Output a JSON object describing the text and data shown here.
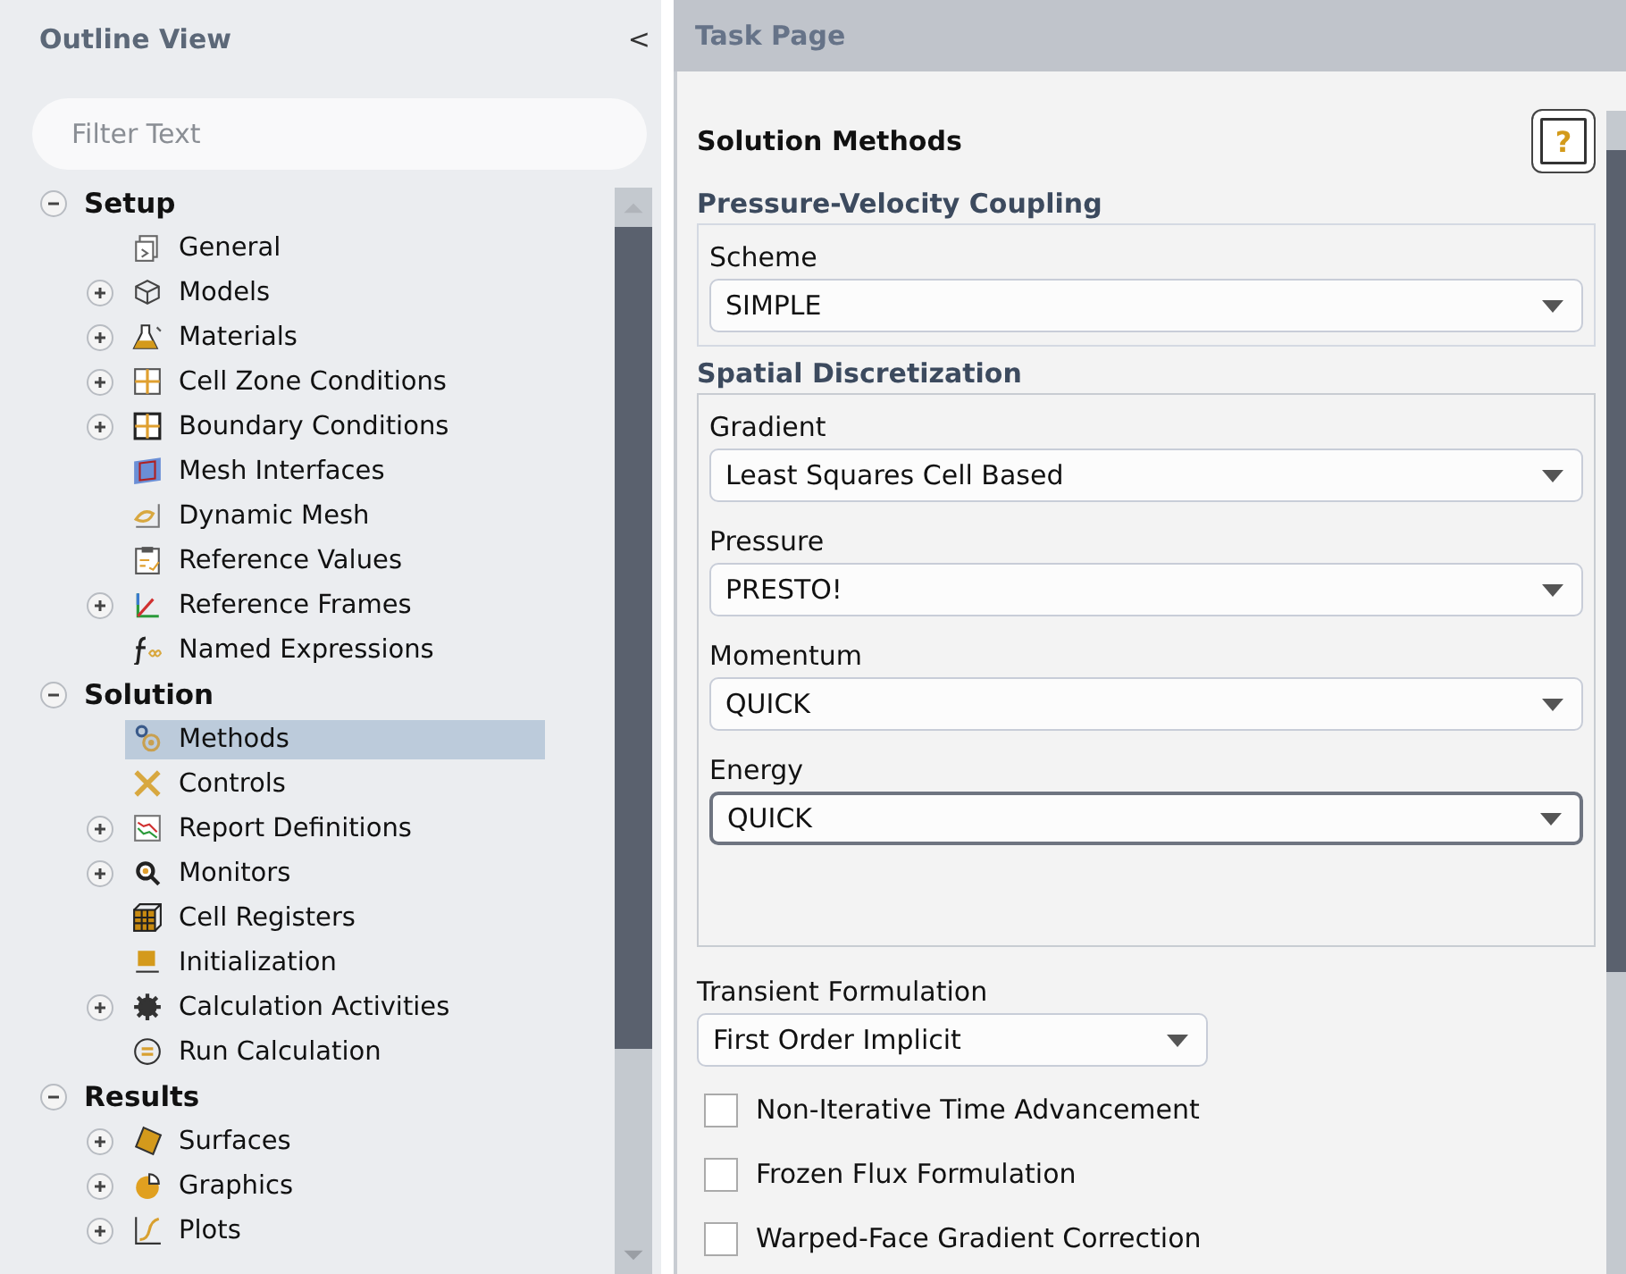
{
  "outline": {
    "title": "Outline View",
    "collapse_glyph": "<",
    "filter": {
      "placeholder": "Filter Text"
    },
    "tree": [
      {
        "label": "Setup",
        "expanded": true,
        "children": [
          {
            "label": "General"
          },
          {
            "label": "Models",
            "expanded": false
          },
          {
            "label": "Materials",
            "expanded": false
          },
          {
            "label": "Cell Zone Conditions",
            "expanded": false
          },
          {
            "label": "Boundary Conditions",
            "expanded": false
          },
          {
            "label": "Mesh Interfaces"
          },
          {
            "label": "Dynamic Mesh"
          },
          {
            "label": "Reference Values"
          },
          {
            "label": "Reference Frames",
            "expanded": false
          },
          {
            "label": "Named Expressions"
          }
        ]
      },
      {
        "label": "Solution",
        "expanded": true,
        "children": [
          {
            "label": "Methods",
            "selected": true
          },
          {
            "label": "Controls",
            "selected": false
          },
          {
            "label": "Report Definitions",
            "expanded": false,
            "selected": false
          },
          {
            "label": "Monitors",
            "expanded": false,
            "selected": false
          },
          {
            "label": "Cell Registers",
            "selected": false
          },
          {
            "label": "Initialization",
            "selected": false
          },
          {
            "label": "Calculation Activities",
            "expanded": false,
            "selected": false
          },
          {
            "label": "Run Calculation",
            "selected": false
          }
        ]
      },
      {
        "label": "Results",
        "expanded": true,
        "children": [
          {
            "label": "Surfaces",
            "expanded": false
          },
          {
            "label": "Graphics",
            "expanded": false
          },
          {
            "label": "Plots",
            "expanded": false
          }
        ]
      }
    ]
  },
  "task_page": {
    "title": "Task Page",
    "heading": "Solution Methods",
    "help_button": "?",
    "sections": [
      {
        "title": "Pressure-Velocity Coupling",
        "fields": [
          {
            "label": "Scheme",
            "value": "SIMPLE",
            "focused": false
          }
        ]
      },
      {
        "title": "Spatial Discretization",
        "fields": [
          {
            "label": "Gradient",
            "value": "Least Squares Cell Based",
            "focused": false
          },
          {
            "label": "Pressure",
            "value": "PRESTO!",
            "focused": false
          },
          {
            "label": "Momentum",
            "value": "QUICK",
            "focused": false
          },
          {
            "label": "Energy",
            "value": "QUICK",
            "focused": true
          }
        ]
      }
    ],
    "transient": {
      "label": "Transient Formulation",
      "value": "First Order Implicit"
    },
    "options": [
      {
        "label": "Non-Iterative Time Advancement",
        "checked": false
      },
      {
        "label": "Frozen Flux Formulation",
        "checked": false
      },
      {
        "label": "Warped-Face Gradient Correction",
        "checked": false
      }
    ]
  }
}
